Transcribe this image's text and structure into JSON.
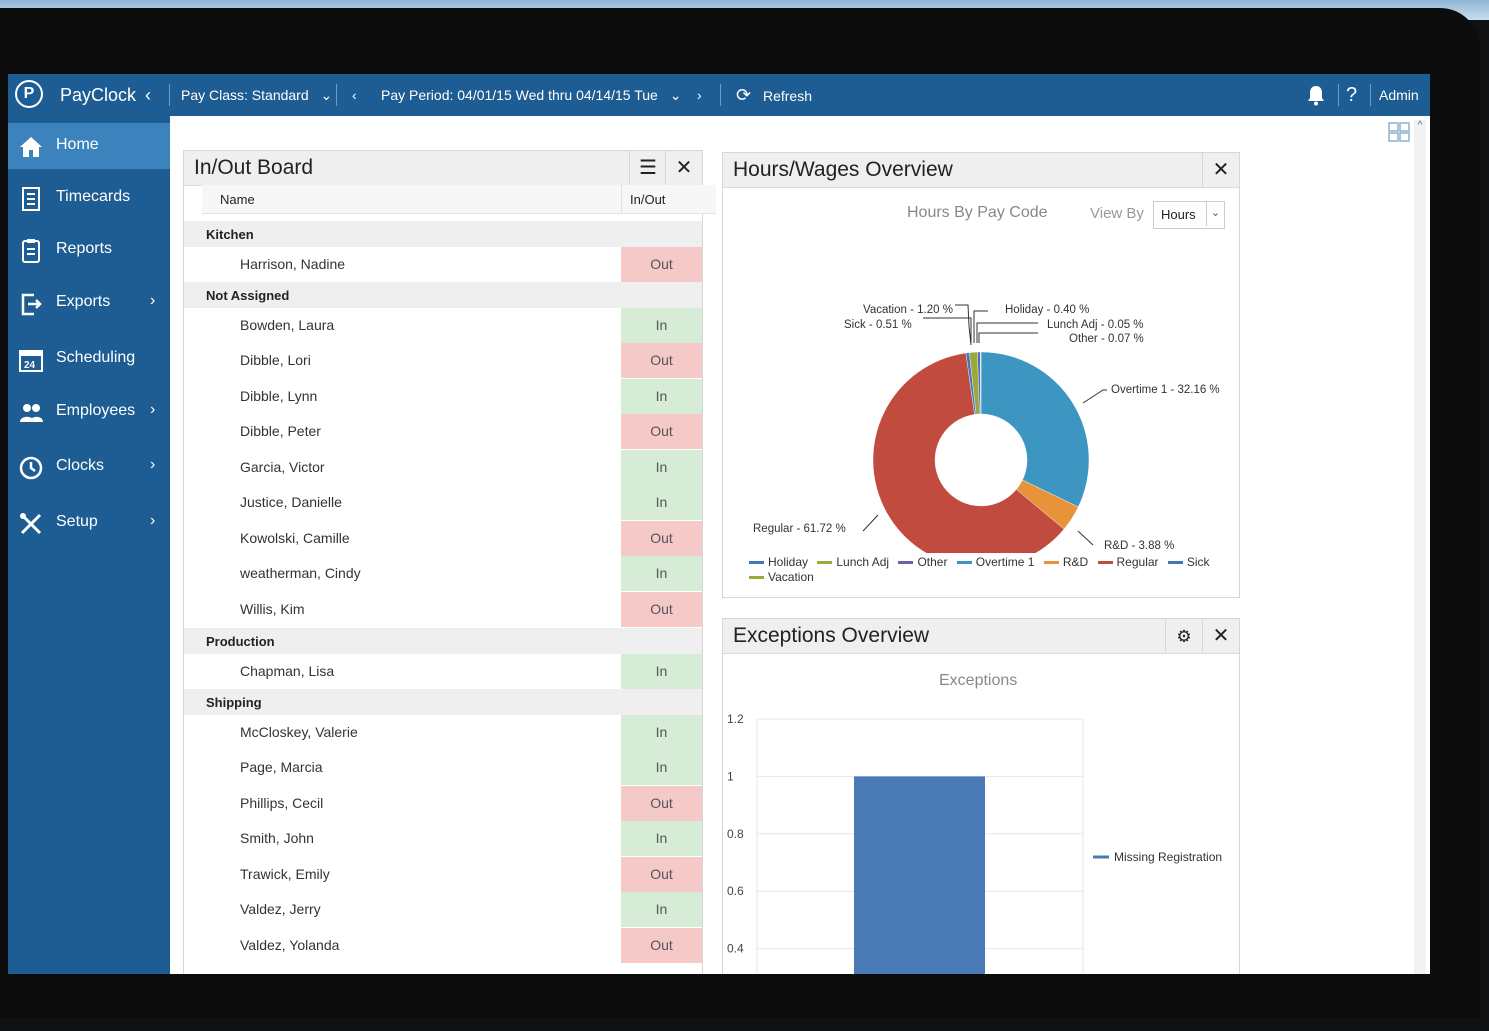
{
  "topbar": {
    "app_name": "PayClock",
    "pay_class": "Pay Class: Standard",
    "pay_period": "Pay Period: 04/01/15 Wed thru 04/14/15 Tue",
    "refresh_label": "Refresh",
    "help_label": "?",
    "user": "Admin",
    "icons": [
      "paycloc-logo-icon",
      "chevron-left-icon",
      "chevron-down-icon",
      "refresh-icon",
      "bell-icon"
    ]
  },
  "sidebar": {
    "items": [
      {
        "label": "Home",
        "icon": "home-icon",
        "active": true
      },
      {
        "label": "Timecards",
        "icon": "timecard-icon"
      },
      {
        "label": "Reports",
        "icon": "report-icon"
      },
      {
        "label": "Exports",
        "icon": "export-icon",
        "submenu": true
      },
      {
        "label": "Scheduling",
        "icon": "calendar-icon"
      },
      {
        "label": "Employees",
        "icon": "people-icon",
        "submenu": true
      },
      {
        "label": "Clocks",
        "icon": "clock-icon",
        "submenu": true
      },
      {
        "label": "Setup",
        "icon": "tools-icon",
        "submenu": true
      }
    ]
  },
  "inout": {
    "title": "In/Out Board",
    "col_name": "Name",
    "col_status": "In/Out",
    "groups": [
      {
        "name": "Kitchen",
        "rows": [
          {
            "name": "Harrison, Nadine",
            "status": "Out"
          }
        ]
      },
      {
        "name": "Not Assigned",
        "rows": [
          {
            "name": "Bowden, Laura",
            "status": "In"
          },
          {
            "name": "Dibble, Lori",
            "status": "Out"
          },
          {
            "name": "Dibble, Lynn",
            "status": "In"
          },
          {
            "name": "Dibble, Peter",
            "status": "Out"
          },
          {
            "name": "Garcia, Victor",
            "status": "In"
          },
          {
            "name": "Justice, Danielle",
            "status": "In"
          },
          {
            "name": "Kowolski, Camille",
            "status": "Out"
          },
          {
            "name": "weatherman, Cindy",
            "status": "In"
          },
          {
            "name": "Willis, Kim",
            "status": "Out"
          }
        ]
      },
      {
        "name": "Production",
        "rows": [
          {
            "name": "Chapman, Lisa",
            "status": "In"
          }
        ]
      },
      {
        "name": "Shipping",
        "rows": [
          {
            "name": "McCloskey, Valerie",
            "status": "In"
          },
          {
            "name": "Page, Marcia",
            "status": "In"
          },
          {
            "name": "Phillips, Cecil",
            "status": "Out"
          },
          {
            "name": "Smith, John",
            "status": "In"
          },
          {
            "name": "Trawick, Emily",
            "status": "Out"
          },
          {
            "name": "Valdez, Jerry",
            "status": "In"
          },
          {
            "name": "Valdez, Yolanda",
            "status": "Out"
          }
        ]
      }
    ]
  },
  "hours": {
    "title": "Hours/Wages Overview",
    "chart_title": "Hours By Pay Code",
    "view_by_label": "View By",
    "view_by_value": "Hours"
  },
  "exceptions": {
    "title": "Exceptions Overview",
    "chart_title": "Exceptions"
  },
  "colors": {
    "in": "#d7ecd6",
    "out": "#f6c9c9",
    "brand": "#1d5d93",
    "active": "#3c83bd"
  },
  "chart_data": [
    {
      "type": "pie",
      "title": "Hours By Pay Code",
      "slices": [
        {
          "label": "Overtime 1",
          "display": "Overtime 1 - 32.16 %",
          "value": 32.16,
          "color": "#3d96c1"
        },
        {
          "label": "R&D",
          "display": "R&D - 3.88 %",
          "value": 3.88,
          "color": "#e8923a"
        },
        {
          "label": "Regular",
          "display": "Regular - 61.72 %",
          "value": 61.72,
          "color": "#c14b3f"
        },
        {
          "label": "Sick",
          "display": "Sick - 0.51 %",
          "value": 0.51,
          "color": "#3f77b8"
        },
        {
          "label": "Vacation",
          "display": "Vacation - 1.20 %",
          "value": 1.2,
          "color": "#9aa83c"
        },
        {
          "label": "Holiday",
          "display": "Holiday - 0.40 %",
          "value": 0.4,
          "color": "#4a6fb0"
        },
        {
          "label": "Lunch Adj",
          "display": "Lunch Adj - 0.05 %",
          "value": 0.05,
          "color": "#8cab3c"
        },
        {
          "label": "Other",
          "display": "Other - 0.07 %",
          "value": 0.07,
          "color": "#6b62a8"
        }
      ],
      "legend": [
        {
          "name": "Holiday",
          "color": "#3f77b8"
        },
        {
          "name": "Lunch Adj",
          "color": "#9aa83c"
        },
        {
          "name": "Other",
          "color": "#6b62a8"
        },
        {
          "name": "Overtime 1",
          "color": "#3d96c1"
        },
        {
          "name": "R&D",
          "color": "#e8923a"
        },
        {
          "name": "Regular",
          "color": "#c14b3f"
        },
        {
          "name": "Sick",
          "color": "#3f77b8"
        },
        {
          "name": "Vacation",
          "color": "#9aa83c"
        }
      ]
    },
    {
      "type": "bar",
      "title": "Exceptions",
      "categories": [
        ""
      ],
      "series": [
        {
          "name": "Missing Registration",
          "values": [
            1
          ],
          "color": "#4a7ab5"
        }
      ],
      "yticks": [
        "1.2",
        "1",
        "0.8",
        "0.6",
        "0.4"
      ],
      "ylim": [
        0,
        1.2
      ]
    }
  ]
}
